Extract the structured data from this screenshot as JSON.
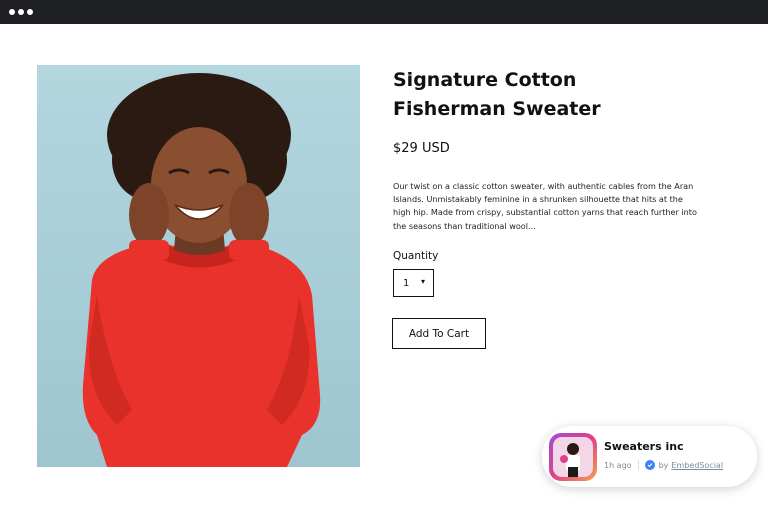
{
  "product": {
    "title": "Signature Cotton Fisherman Sweater",
    "price": "$29 USD",
    "description": "Our twist on a classic cotton sweater, with authentic cables from the Aran Islands. Unmistakably feminine in a shrunken silhouette that hits at the high hip. Made from crispy, substantial cotton yarns that reach further into the seasons than traditional wool...",
    "quantity_label": "Quantity",
    "quantity_value": "1",
    "add_to_cart_label": "Add To Cart"
  },
  "widget": {
    "name": "Sweaters inc",
    "time": "1h ago",
    "by_label": "by",
    "brand": "EmbedSocial"
  },
  "colors": {
    "titlebar": "#1e2024",
    "sweater": "#e8322b",
    "photo_bg": "#a9cfd8"
  },
  "icons": {
    "window_controls": "three-dots-icon",
    "dropdown": "caret-down-icon",
    "verified": "check-badge-icon"
  }
}
